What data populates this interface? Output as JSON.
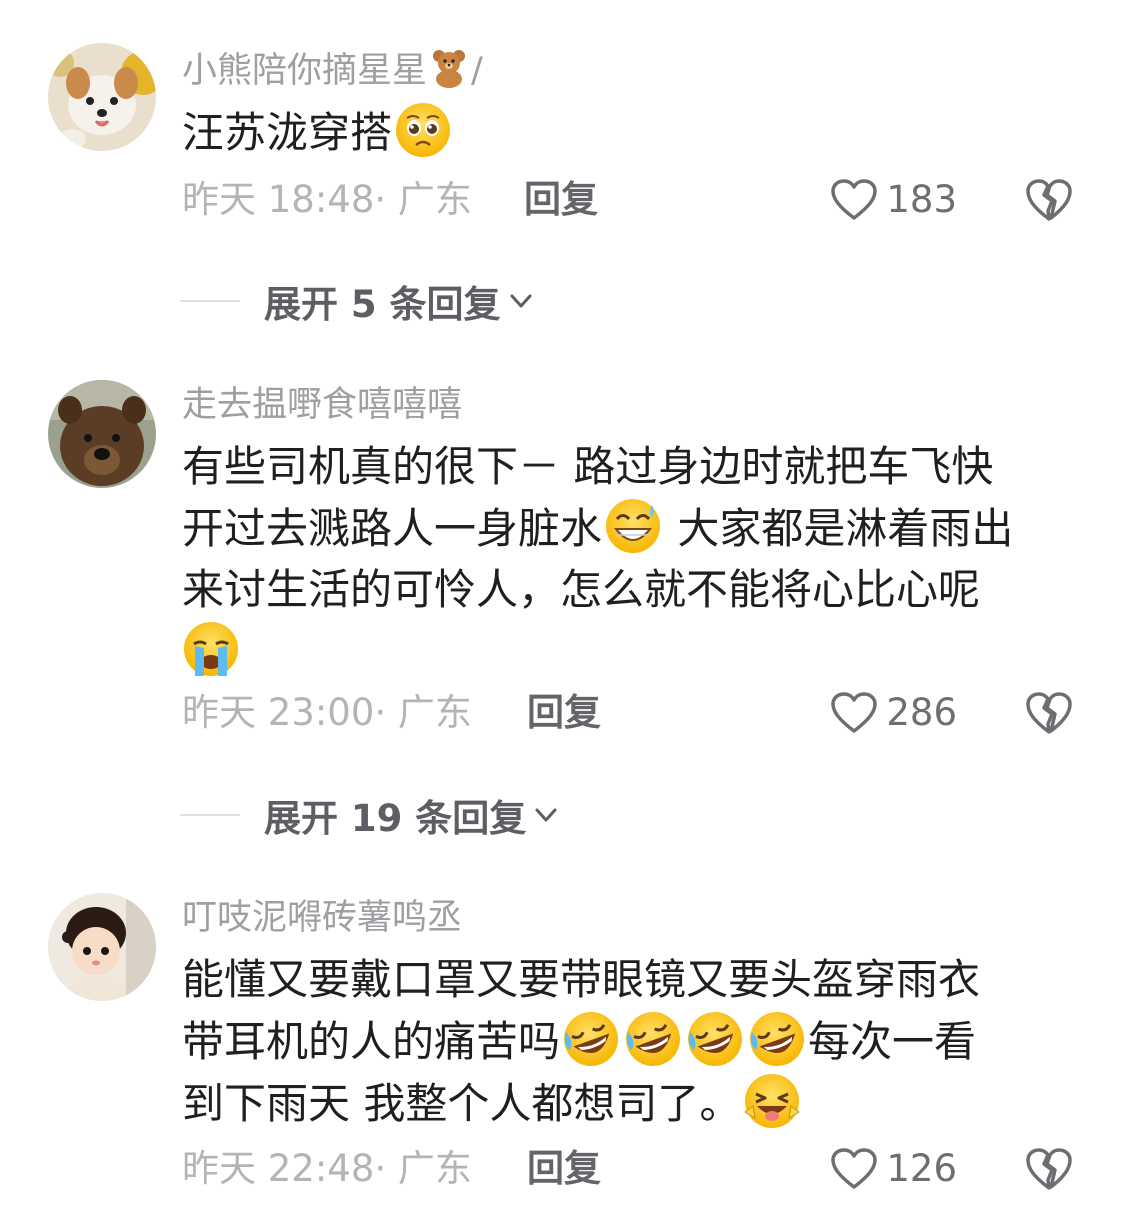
{
  "comments": [
    {
      "username": "小熊陪你摘星星",
      "username_suffix": "/",
      "username_emoji": "teddy-bear-icon",
      "text_parts": [
        "汪苏泷穿搭"
      ],
      "text_emoji": "pleading-face-icon",
      "time": "昨天 18:48",
      "location": "· 广东",
      "reply_label": "回复",
      "likes": "183"
    },
    {
      "username": "走去揾嘢食嘻嘻嘻",
      "text_line1": "有些司机真的很下－  路过身边时就把车飞快",
      "text_line2a": "开过去溅路人一身脏水",
      "text_line2b": " 大家都是淋着雨出",
      "text_line3": "来讨生活的可怜人，怎么就不能将心比心呢",
      "emoji_a": "grinning-sweat-icon",
      "emoji_b": "crying-face-icon",
      "time": "昨天 23:00",
      "location": "· 广东",
      "reply_label": "回复",
      "likes": "286"
    },
    {
      "username": "叮吱泥嘚砖薯鸣丞",
      "text_line1": "能懂又要戴口罩又要带眼镜又要头盔穿雨衣",
      "text_line2a": "带耳机的人的痛苦吗",
      "text_line2b": "每次一看",
      "text_line3": "到下雨天 我整个人都想司了。",
      "emoji_a": "rolling-laughing-icon",
      "emoji_b": "winking-tongue-icon",
      "time": "昨天 22:48",
      "location": "· 广东",
      "reply_label": "回复",
      "likes": "126"
    }
  ],
  "expanders": [
    {
      "label": "展开 5 条回复"
    },
    {
      "label": "展开 19 条回复"
    }
  ],
  "colors": {
    "username": "#9d9fa3",
    "body": "#1f1f22",
    "meta": "#b2b4b8",
    "reply": "#63656a",
    "emoji_yellow": "#fcc21b"
  }
}
